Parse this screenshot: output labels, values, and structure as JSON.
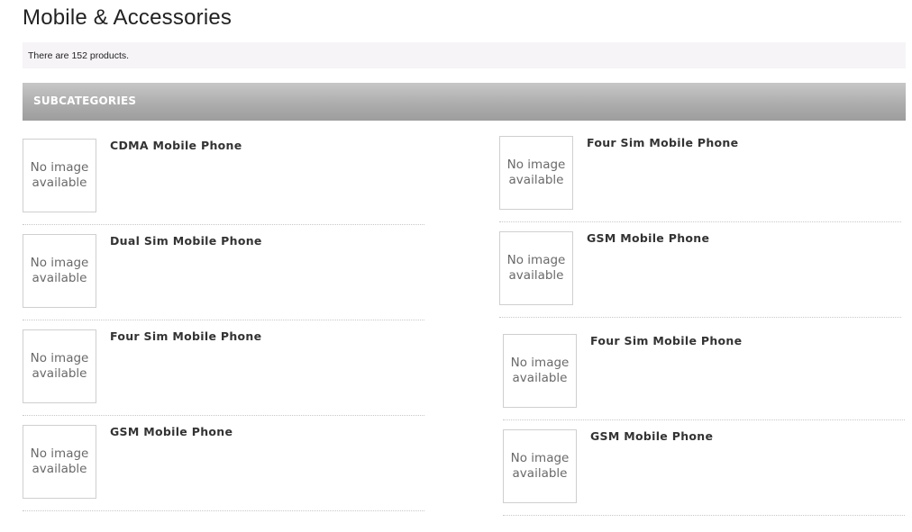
{
  "page": {
    "title": "Mobile & Accessories",
    "product_count_text": "There are 152 products."
  },
  "subcategories": {
    "header": "SUBCATEGORIES",
    "no_image_line1": "No image",
    "no_image_line2": "available",
    "left": [
      {
        "name": "CDMA Mobile Phone"
      },
      {
        "name": "Dual Sim Mobile Phone"
      },
      {
        "name": "Four Sim Mobile Phone"
      },
      {
        "name": "GSM Mobile Phone"
      }
    ],
    "right": [
      {
        "name": "Four Sim Mobile Phone"
      },
      {
        "name": "GSM Mobile Phone"
      },
      {
        "name": "Four Sim Mobile Phone"
      },
      {
        "name": "GSM Mobile Phone"
      }
    ]
  },
  "colors": {
    "header_bar": "#adadad",
    "count_bar_bg": "#f6f4f7",
    "thumb_border": "#cfcfcf"
  }
}
